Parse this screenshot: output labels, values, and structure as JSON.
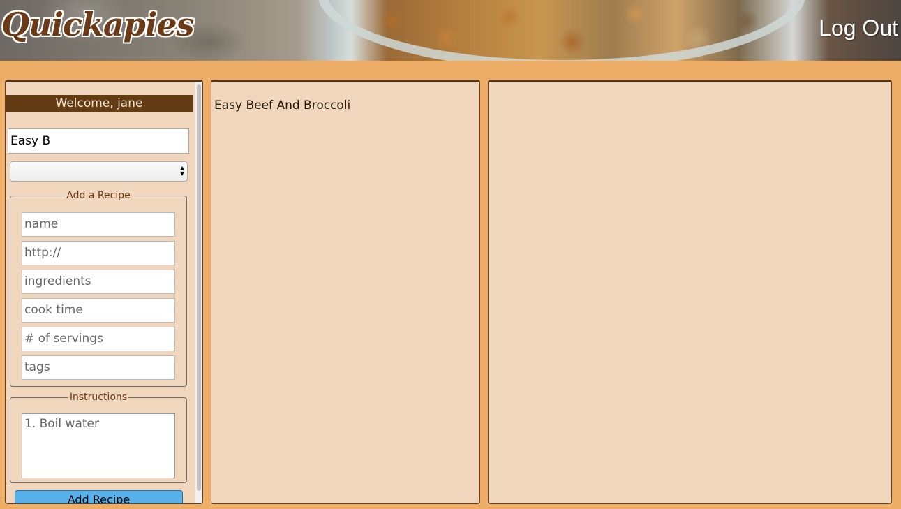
{
  "header": {
    "logo": "Quickapies",
    "logout_label": "Log Out"
  },
  "sidebar": {
    "welcome": "Welcome, jane",
    "search_value": "Easy B",
    "select_value": "",
    "add_recipe": {
      "legend": "Add a Recipe",
      "placeholders": {
        "name": "name",
        "url": "http://",
        "ingredients": "ingredients",
        "cook_time": "cook time",
        "servings": "# of servings",
        "tags": "tags"
      }
    },
    "instructions": {
      "legend": "Instructions",
      "placeholder": "1. Boil water"
    },
    "submit_label": "Add Recipe"
  },
  "results": {
    "items": [
      "Easy Beef And Broccoli"
    ]
  },
  "colors": {
    "background": "#efae67",
    "panel": "#efd6bd",
    "accent_dark": "#643c14",
    "button": "#56b0ea"
  }
}
